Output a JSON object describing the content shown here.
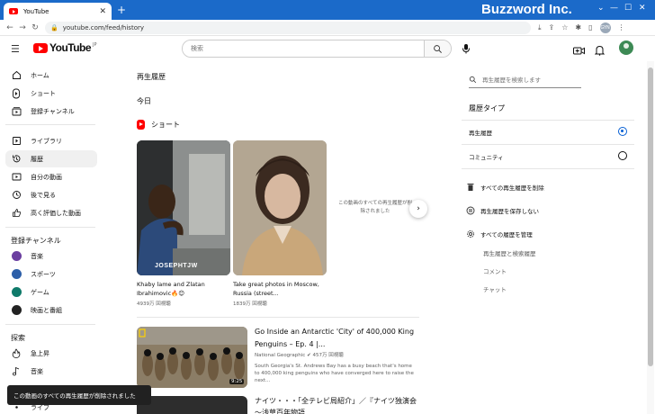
{
  "browser": {
    "tab_title": "YouTube",
    "new_tab": "+",
    "brand": "Buzzword Inc.",
    "url": "youtube.com/feed/history",
    "profile_initials": "GYN"
  },
  "header": {
    "search_placeholder": "検索",
    "logo_text": "YouTube",
    "logo_region": "JP"
  },
  "sidebar": {
    "main_items": [
      {
        "label": "ホーム"
      },
      {
        "label": "ショート"
      },
      {
        "label": "登録チャンネル"
      }
    ],
    "library_items": [
      {
        "label": "ライブラリ"
      },
      {
        "label": "履歴"
      },
      {
        "label": "自分の動画"
      },
      {
        "label": "後で見る"
      },
      {
        "label": "高く評価した動画"
      }
    ],
    "subscriptions_heading": "登録チャンネル",
    "subscriptions": [
      {
        "label": "音楽",
        "color": "#6b3fa0"
      },
      {
        "label": "スポーツ",
        "color": "#2d5fa8"
      },
      {
        "label": "ゲーム",
        "color": "#0f7a6a"
      },
      {
        "label": "映画と番組",
        "color": "#222222"
      }
    ],
    "explore_heading": "探索",
    "explore_items": [
      {
        "label": "急上昇"
      },
      {
        "label": "音楽"
      },
      {
        "label": "ライブ"
      }
    ]
  },
  "main": {
    "page_title": "再生履歴",
    "section_today": "今日",
    "shorts_label": "ショート",
    "shorts": [
      {
        "title": "Khaby lame and Zlatan Ibrahimovic🔥😊",
        "views": "4939万 回視聴",
        "watermark": "JOSEPHTJW"
      },
      {
        "title": "Take great photos in Moscow, Russia (street...",
        "views": "1839万 回視聴"
      }
    ],
    "removed_notice": "この動画のすべての再生履歴が削除されました",
    "videos": [
      {
        "title": "Go Inside an Antarctic 'City' of 400,000 King Penguins – Ep. 4 |...",
        "channel": "National Geographic",
        "views": "457万 回視聴",
        "description": "South Georgia's St. Andrews Bay has a busy beach that's home to 400,000 king penguins who have converged here to raise the next...",
        "duration": "9:25"
      },
      {
        "title": "ナイツ・・・「全テレビ局紹介」／『ナイツ独演会～浅草百年物語..."
      }
    ]
  },
  "right_panel": {
    "search_placeholder": "再生履歴を検索します",
    "history_type_heading": "履歴タイプ",
    "options": [
      {
        "label": "再生履歴",
        "selected": true
      },
      {
        "label": "コミュニティ",
        "selected": false
      }
    ],
    "actions": [
      {
        "label": "すべての再生履歴を削除"
      },
      {
        "label": "再生履歴を保存しない"
      },
      {
        "label": "すべての履歴を管理"
      }
    ],
    "sub_links": [
      {
        "label": "再生履歴と検索履歴"
      },
      {
        "label": "コメント"
      },
      {
        "label": "チャット"
      }
    ]
  },
  "toast": {
    "message": "この動画のすべての再生履歴が削除されました"
  }
}
